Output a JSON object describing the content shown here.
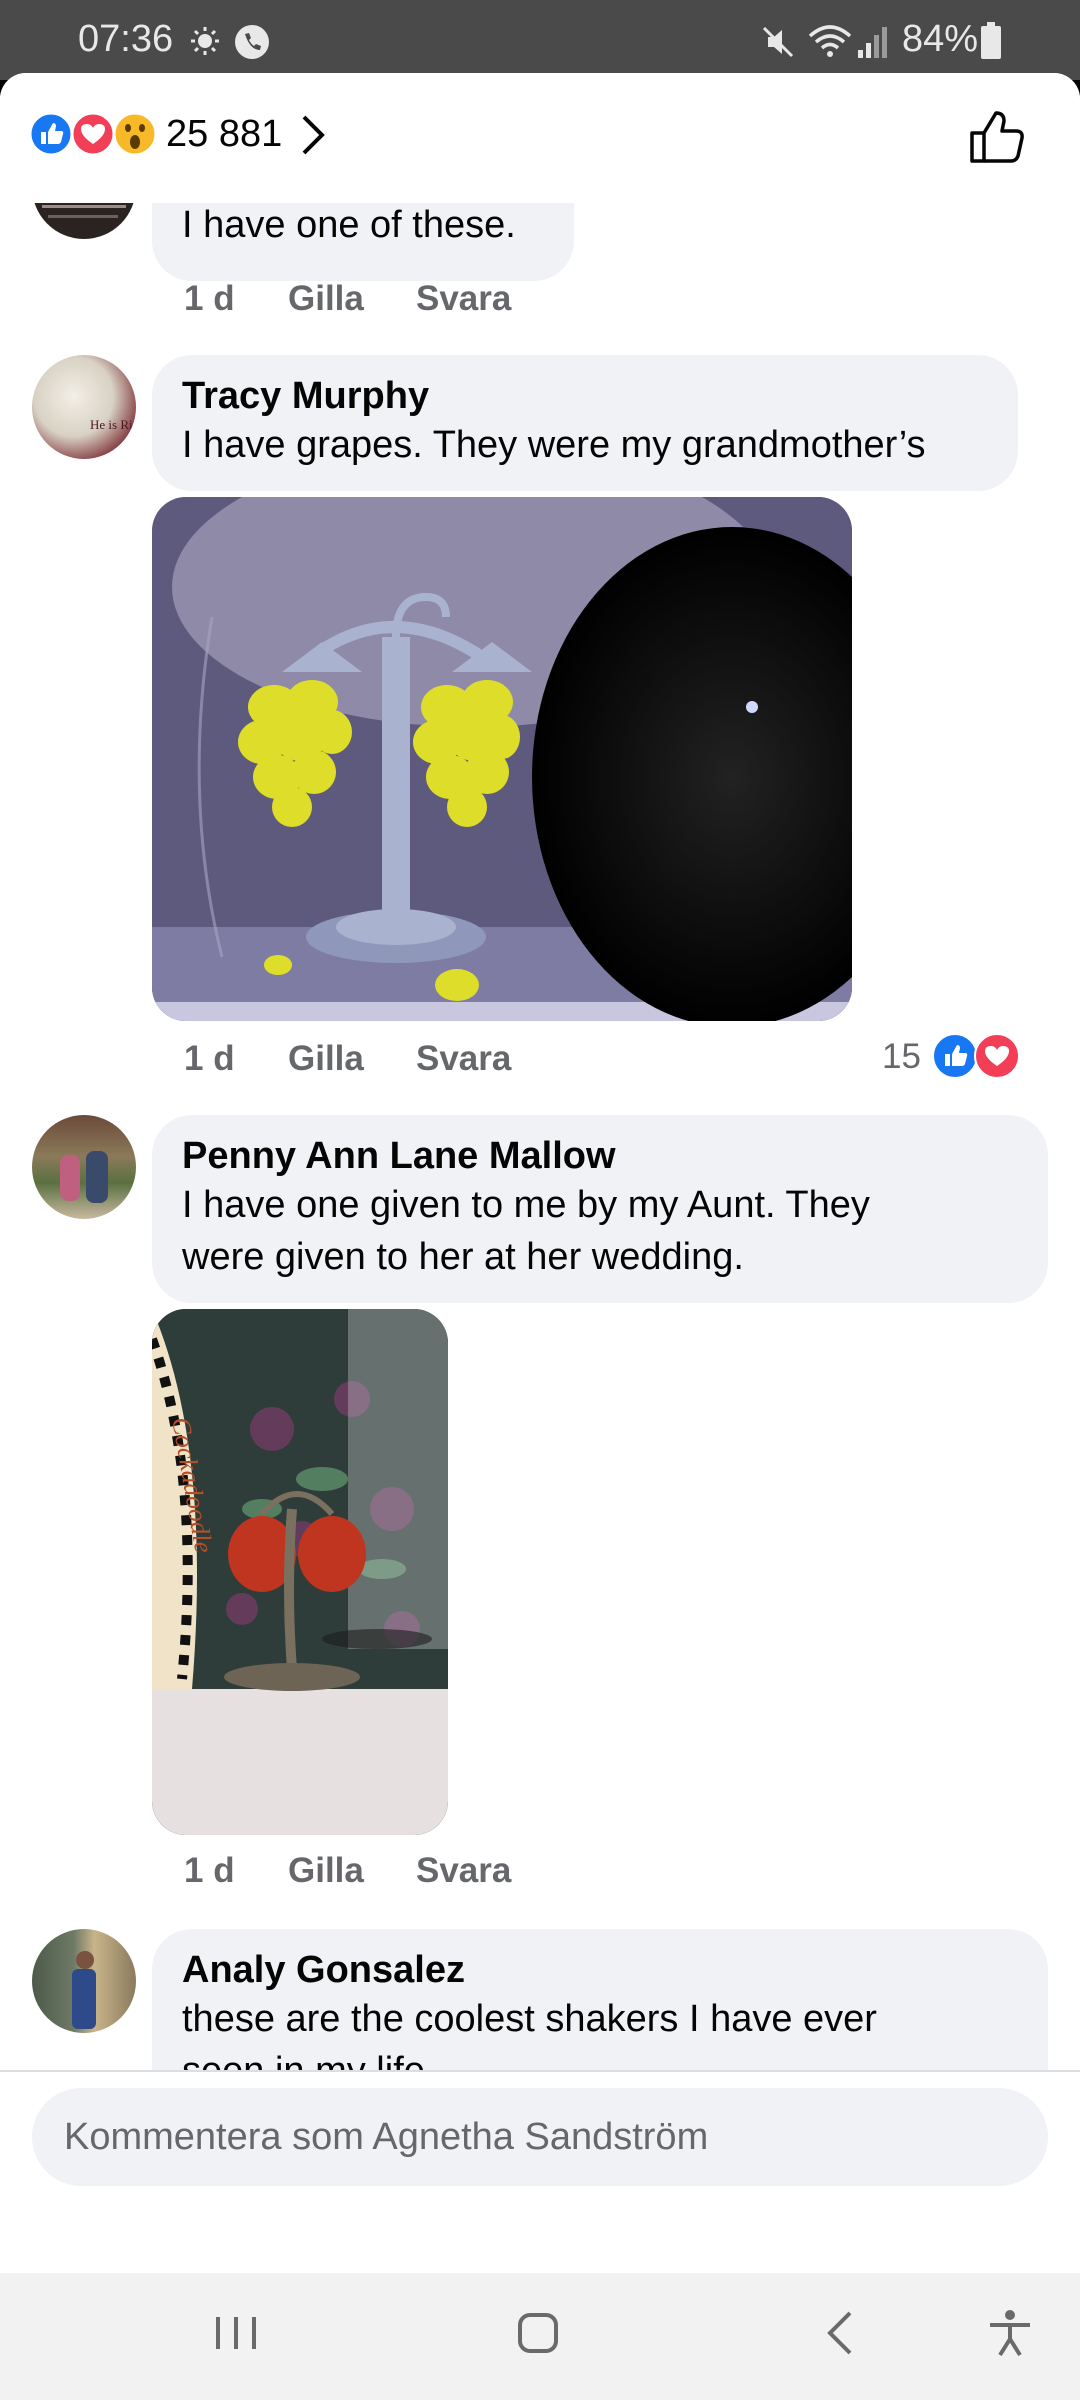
{
  "status_bar": {
    "time": "07:36",
    "battery": "84%",
    "icons": [
      "sun-icon",
      "phone-call-icon",
      "mute-icon",
      "wifi-icon",
      "signal-icon",
      "battery-icon"
    ]
  },
  "reactions_header": {
    "count": "25 881",
    "icons": [
      "like-reaction-icon",
      "love-reaction-icon",
      "wow-reaction-icon",
      "chevron-right-icon",
      "like-outline-icon"
    ]
  },
  "comments": [
    {
      "author": "",
      "text": "I have one of these.",
      "time": "1 d",
      "like_label": "Gilla",
      "reply_label": "Svara"
    },
    {
      "author": "Tracy Murphy",
      "text": "I have grapes. They were my grandmother’s",
      "time": "1 d",
      "like_label": "Gilla",
      "reply_label": "Svara",
      "reaction_count": "15",
      "reaction_icons": [
        "like-reaction-icon",
        "love-reaction-icon"
      ],
      "avatar_caption": "He is Ri"
    },
    {
      "author": "Penny Ann Lane Mallow",
      "text_line1": "I have one given to me by my Aunt.  They",
      "text_line2": "were given to her at her wedding.",
      "time": "1 d",
      "like_label": "Gilla",
      "reply_label": "Svara",
      "photo_lettering": "Cockadoodle"
    },
    {
      "author": "Analy Gonsalez",
      "text_line1": "these are the coolest shakers I have ever",
      "text_line2": "seen in my life"
    }
  ],
  "composer": {
    "placeholder": "Kommentera som Agnetha Sandström"
  },
  "nav_bar": {
    "icons": [
      "recent-apps-icon",
      "home-icon",
      "back-icon",
      "accessibility-icon"
    ]
  },
  "colors": {
    "like_blue": "#1877f2",
    "love_red": "#f33e58",
    "bubble_bg": "#f0f2f5",
    "meta_gray": "#65676b"
  }
}
